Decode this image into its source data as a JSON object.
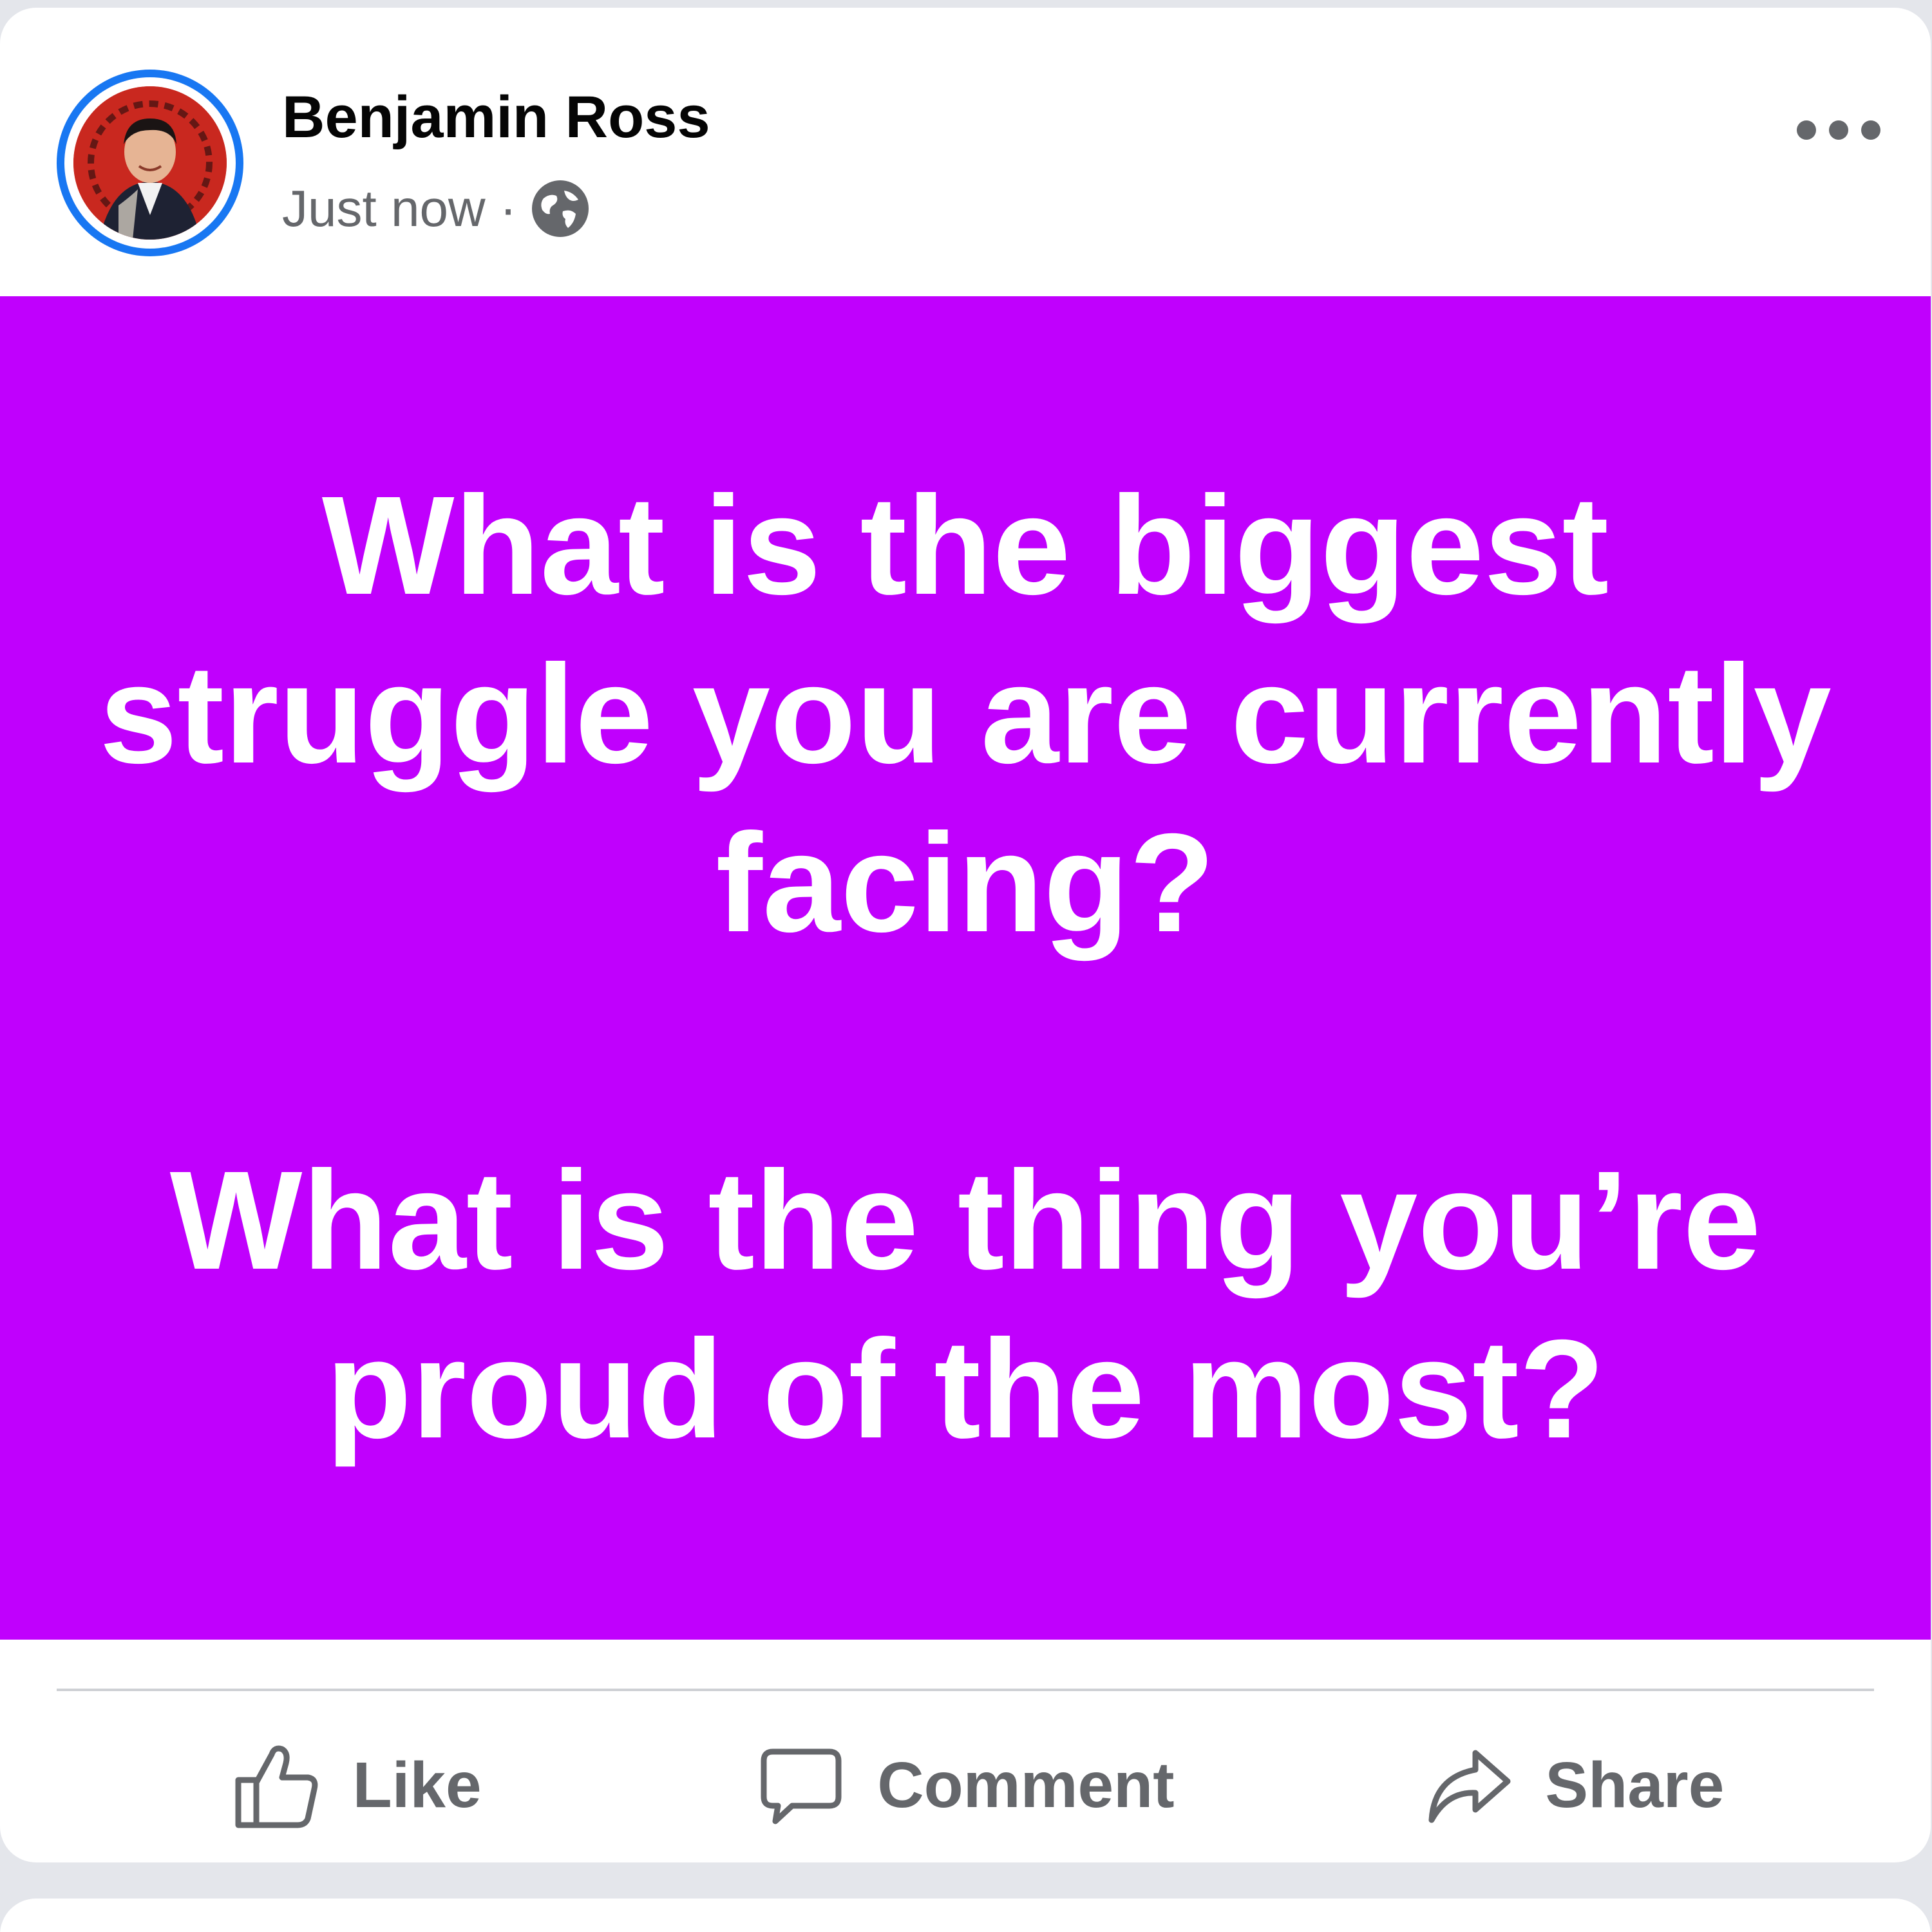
{
  "post": {
    "author": "Benjamin Ross",
    "timestamp": "Just now",
    "separator": "·",
    "audience_icon": "globe-icon",
    "more_icon": "more-options-icon",
    "background_color": "#c000fd",
    "text_color": "#ffffff",
    "text_paragraphs": [
      "What is the biggest struggle you are currently facing?",
      "What is the thing you’re proud of the most?"
    ]
  },
  "actions": {
    "like": {
      "label": "Like",
      "icon": "thumbs-up-icon"
    },
    "comment": {
      "label": "Comment",
      "icon": "comment-icon"
    },
    "share": {
      "label": "Share",
      "icon": "share-icon"
    }
  },
  "colors": {
    "accent": "#1877f2",
    "secondary_text": "#65676b",
    "primary_text": "#050505"
  }
}
